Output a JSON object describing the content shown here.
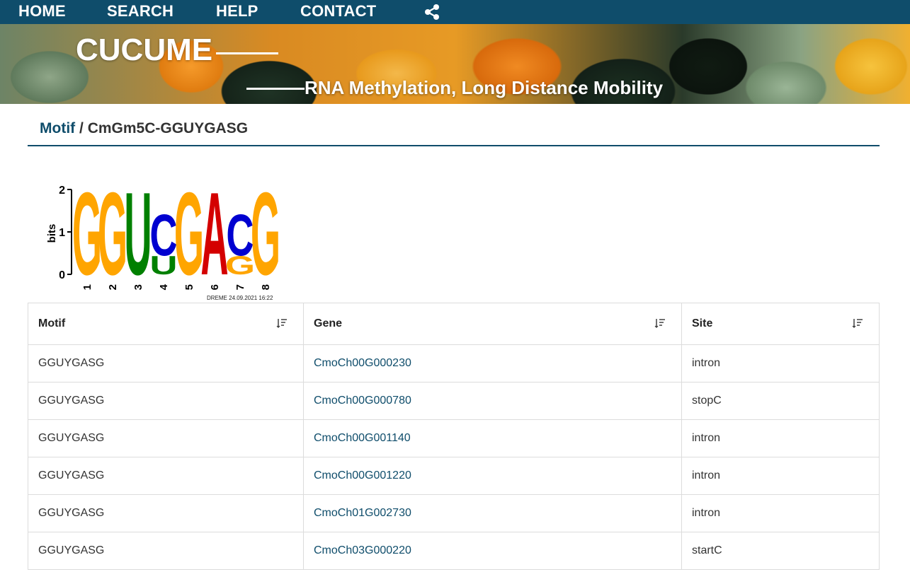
{
  "nav": {
    "items": [
      {
        "label": "HOME"
      },
      {
        "label": "SEARCH"
      },
      {
        "label": "HELP"
      },
      {
        "label": "CONTACT"
      }
    ],
    "share_icon": "share-icon"
  },
  "banner": {
    "title": "CUCUME",
    "subtitle": "RNA Methylation, Long Distance Mobility"
  },
  "breadcrumb": {
    "root": "Motif",
    "separator": "/",
    "current": "CmGm5C-GGUYGASG"
  },
  "logo": {
    "ylabel": "bits",
    "yticks": [
      "0",
      "1",
      "2"
    ],
    "positions": [
      "1",
      "2",
      "3",
      "4",
      "5",
      "6",
      "7",
      "8"
    ],
    "caption": "DREME 24.09.2021 16:22",
    "stacks": [
      [
        {
          "letter": "G",
          "bits": 2.0
        }
      ],
      [
        {
          "letter": "G",
          "bits": 2.0
        }
      ],
      [
        {
          "letter": "U",
          "bits": 2.0
        }
      ],
      [
        {
          "letter": "U",
          "bits": 0.45
        },
        {
          "letter": "C",
          "bits": 1.0
        }
      ],
      [
        {
          "letter": "G",
          "bits": 2.0
        }
      ],
      [
        {
          "letter": "A",
          "bits": 2.0
        }
      ],
      [
        {
          "letter": "G",
          "bits": 0.45
        },
        {
          "letter": "C",
          "bits": 1.0
        }
      ],
      [
        {
          "letter": "G",
          "bits": 2.0
        }
      ]
    ],
    "colors": {
      "A": "#d40000",
      "C": "#0000d0",
      "G": "#ffa500",
      "U": "#008000"
    }
  },
  "table": {
    "headers": [
      "Motif",
      "Gene",
      "Site"
    ],
    "rows": [
      {
        "motif": "GGUYGASG",
        "gene": "CmoCh00G000230",
        "site": "intron"
      },
      {
        "motif": "GGUYGASG",
        "gene": "CmoCh00G000780",
        "site": "stopC"
      },
      {
        "motif": "GGUYGASG",
        "gene": "CmoCh00G001140",
        "site": "intron"
      },
      {
        "motif": "GGUYGASG",
        "gene": "CmoCh00G001220",
        "site": "intron"
      },
      {
        "motif": "GGUYGASG",
        "gene": "CmoCh01G002730",
        "site": "intron"
      },
      {
        "motif": "GGUYGASG",
        "gene": "CmoCh03G000220",
        "site": "startC"
      }
    ]
  }
}
